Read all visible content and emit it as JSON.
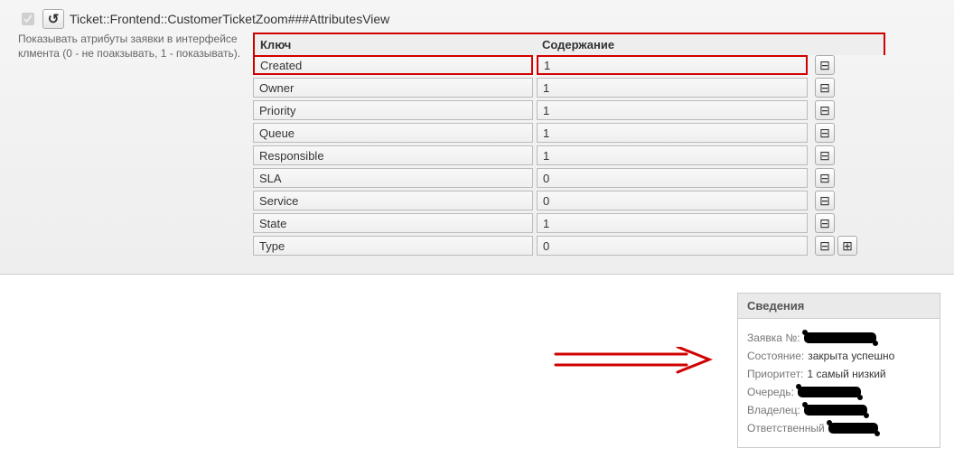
{
  "config": {
    "title": "Ticket::Frontend::CustomerTicketZoom###AttributesView",
    "description": "Показывать атрибуты заявки в интерфейсе клмента (0 - не поакзывать, 1 - показывать).",
    "headers": {
      "key": "Ключ",
      "value": "Содержание"
    },
    "rows": [
      {
        "key": "Created",
        "value": "1",
        "highlight": true
      },
      {
        "key": "Owner",
        "value": "1"
      },
      {
        "key": "Priority",
        "value": "1"
      },
      {
        "key": "Queue",
        "value": "1"
      },
      {
        "key": "Responsible",
        "value": "1"
      },
      {
        "key": "SLA",
        "value": "0"
      },
      {
        "key": "Service",
        "value": "0"
      },
      {
        "key": "State",
        "value": "1"
      },
      {
        "key": "Type",
        "value": "0",
        "last": true
      }
    ]
  },
  "icons": {
    "revert": "↺",
    "minus": "⊟",
    "plus": "⊞"
  },
  "info": {
    "title": "Сведения",
    "ticket_no_label": "Заявка №:",
    "state_label": "Состояние:",
    "state_value": "закрыта успешно",
    "priority_label": "Приоритет:",
    "priority_value": "1 самый низкий",
    "queue_label": "Очередь:",
    "owner_label": "Владелец:",
    "responsible_label": "Ответственный"
  }
}
